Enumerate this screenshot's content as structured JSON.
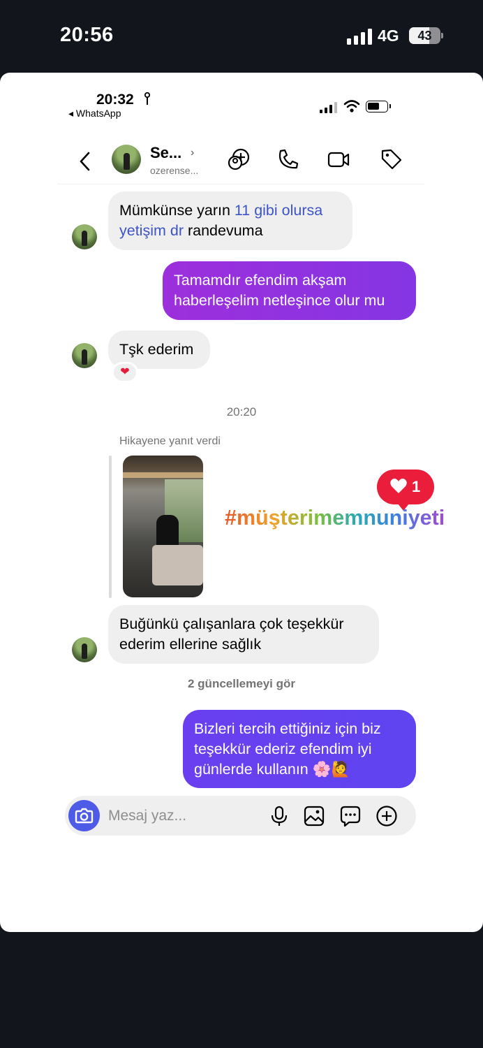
{
  "outer_status": {
    "time": "20:56",
    "network": "4G",
    "battery": "43"
  },
  "inner_status": {
    "time": "20:32",
    "back_app": "◂ WhatsApp"
  },
  "header": {
    "name": "Se...",
    "chevron": "›",
    "username": "ozerense..."
  },
  "messages": [
    {
      "side": "in",
      "parts": [
        "Mümkünse yarın ",
        "11 gibi olursa",
        "yetişim dr",
        " randevuma"
      ]
    },
    {
      "side": "out",
      "text": "Tamamdır efendim akşam haberleşelim netleşince olur mu"
    },
    {
      "side": "in",
      "text": "Tşk ederim",
      "reaction": "❤"
    },
    {
      "side": "in",
      "text": "Buğünkü çalışanlara çok teşekkür ederim ellerine sağlık"
    },
    {
      "side": "out",
      "text": "Bizleri tercih ettiğiniz için biz teşekkür ederiz efendim iyi günlerde kullanın 🌸🙋"
    }
  ],
  "timestamp": "20:20",
  "story": {
    "label": "Hikayene yanıt verdi",
    "like_count": "1",
    "hashtag": "#müşterimemnuniyeti"
  },
  "see_updates": "2 güncellemeyi gör",
  "composer": {
    "placeholder": "Mesaj yaz..."
  },
  "icons": [
    "back-chevron-icon",
    "add-people-icon",
    "phone-icon",
    "video-icon",
    "tag-icon",
    "camera-icon",
    "microphone-icon",
    "gallery-icon",
    "sticker-icon",
    "plus-icon"
  ],
  "colors": {
    "out_bubble_start": "#9d2fdc",
    "out_bubble_end": "#5f44f0",
    "accent": "#4e5be6",
    "like": "#ea1d3a"
  }
}
